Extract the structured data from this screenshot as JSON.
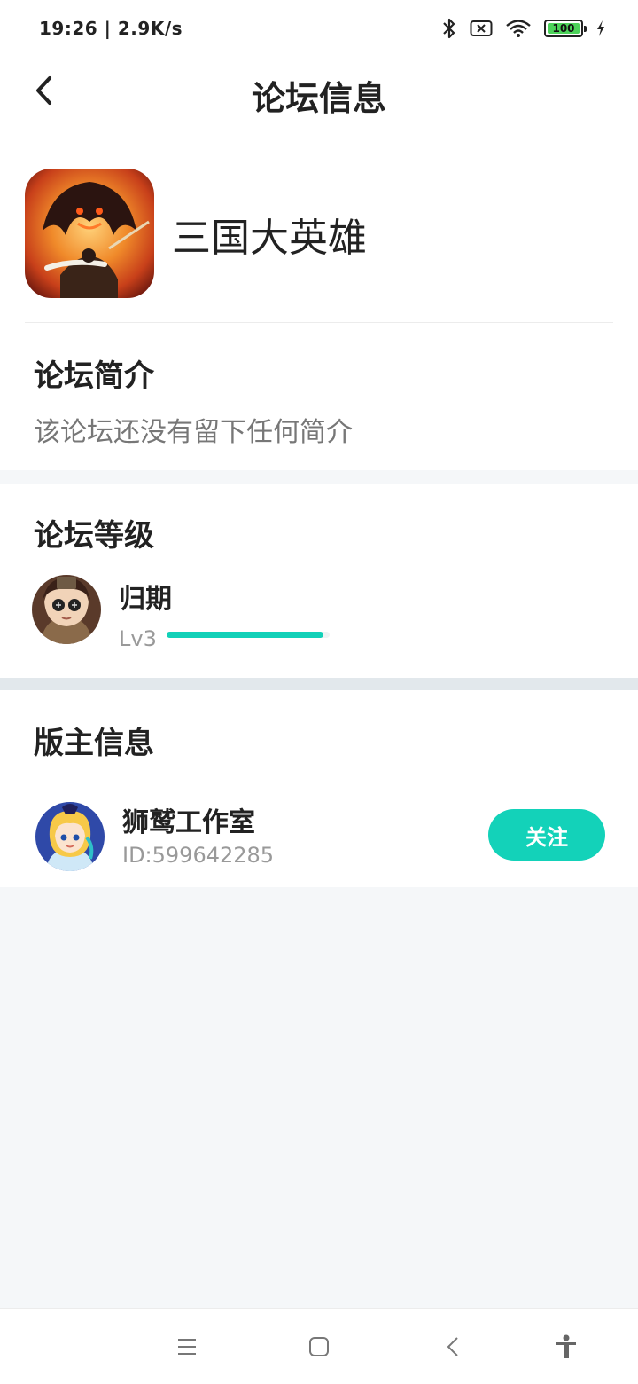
{
  "status_bar": {
    "time_speed": "19:26 | 2.9K/s",
    "battery": "100",
    "icons": [
      "bluetooth-icon",
      "sim-off-icon",
      "wifi-icon",
      "battery-icon",
      "charging-icon"
    ]
  },
  "header": {
    "title": "论坛信息",
    "back_icon": "back-arrow-icon"
  },
  "forum": {
    "name": "三国大英雄"
  },
  "intro": {
    "title": "论坛简介",
    "text": "该论坛还没有留下任何简介"
  },
  "level": {
    "title": "论坛等级",
    "user_name": "归期",
    "user_level": "Lv3",
    "progress": 0.96
  },
  "moderator": {
    "title": "版主信息",
    "name": "狮鹫工作室",
    "id": "ID:599642285",
    "follow_label": "关注"
  },
  "colors": {
    "accent": "#13d2b9",
    "page_bg": "#f5f7f9"
  },
  "system_nav": [
    "menu-icon",
    "home-icon",
    "back-icon",
    "accessibility-icon"
  ]
}
